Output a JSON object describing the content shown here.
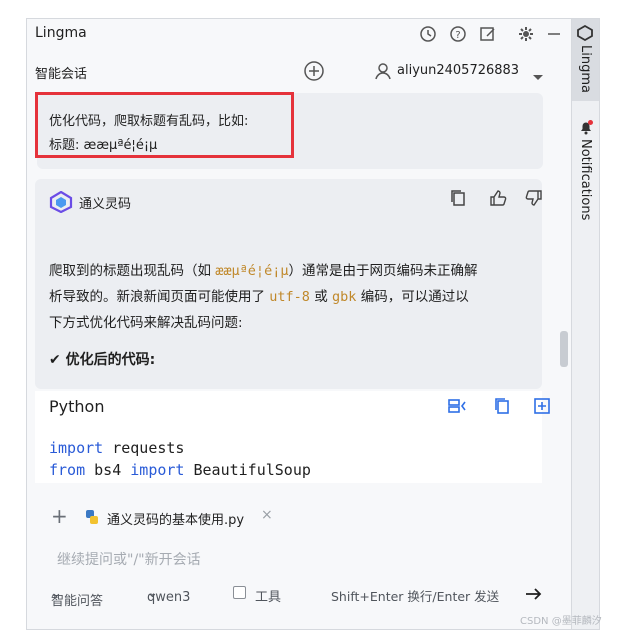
{
  "window": {
    "title": "Lingma",
    "icons": [
      "history-icon",
      "help-icon",
      "edit-icon",
      "gear-icon",
      "minimize-icon"
    ]
  },
  "subheader": {
    "title": "智能会话",
    "username": "aliyun2405726883"
  },
  "user_message": {
    "line1": "优化代码，爬取标题有乱码，比如:",
    "line2": "标题: æ­æµªé¦é¡µ"
  },
  "reply": {
    "brand": "通义灵码",
    "paragraph": {
      "line1_a": "爬取到的标题出现乱码（如 ",
      "line1_code": "æ­æµªé¦é¡µ",
      "line1_b": "）通常是由于网页编码未正确解",
      "line2_a": "析导致的。新浪新闻页面可能使用了 ",
      "line2_code1": "utf-8",
      "line2_b": " 或 ",
      "line2_code2": "gbk",
      "line2_c": " 编码，可以通过以",
      "line3": "下方式优化代码来解决乱码问题:"
    },
    "subheading": "✔ 优化后的代码:"
  },
  "code_block": {
    "language": "Python",
    "lines": [
      {
        "kw": "import",
        "rest": " requests"
      },
      {
        "kw": "from",
        "rest": " bs4 ",
        "kw2": "import",
        "rest2": " BeautifulSoup"
      }
    ]
  },
  "attachment": {
    "filename": "通义灵码的基本使用.py",
    "close": "×"
  },
  "input": {
    "placeholder": "继续提问或\"/\"新开会话"
  },
  "toolbar": {
    "mode": "智能问答",
    "model": "qwen3",
    "tools": "工具",
    "hint": "Shift+Enter 换行/Enter 发送"
  },
  "sidebar": {
    "tab1": "Lingma",
    "tab2": "Notifications"
  },
  "watermark": "CSDN @墨菲麟汐",
  "colors": {
    "highlight": "#e5323b",
    "keyword": "#2a5bd7",
    "inline_code": "#c0882a",
    "accent_icon": "#2f6fe6"
  }
}
